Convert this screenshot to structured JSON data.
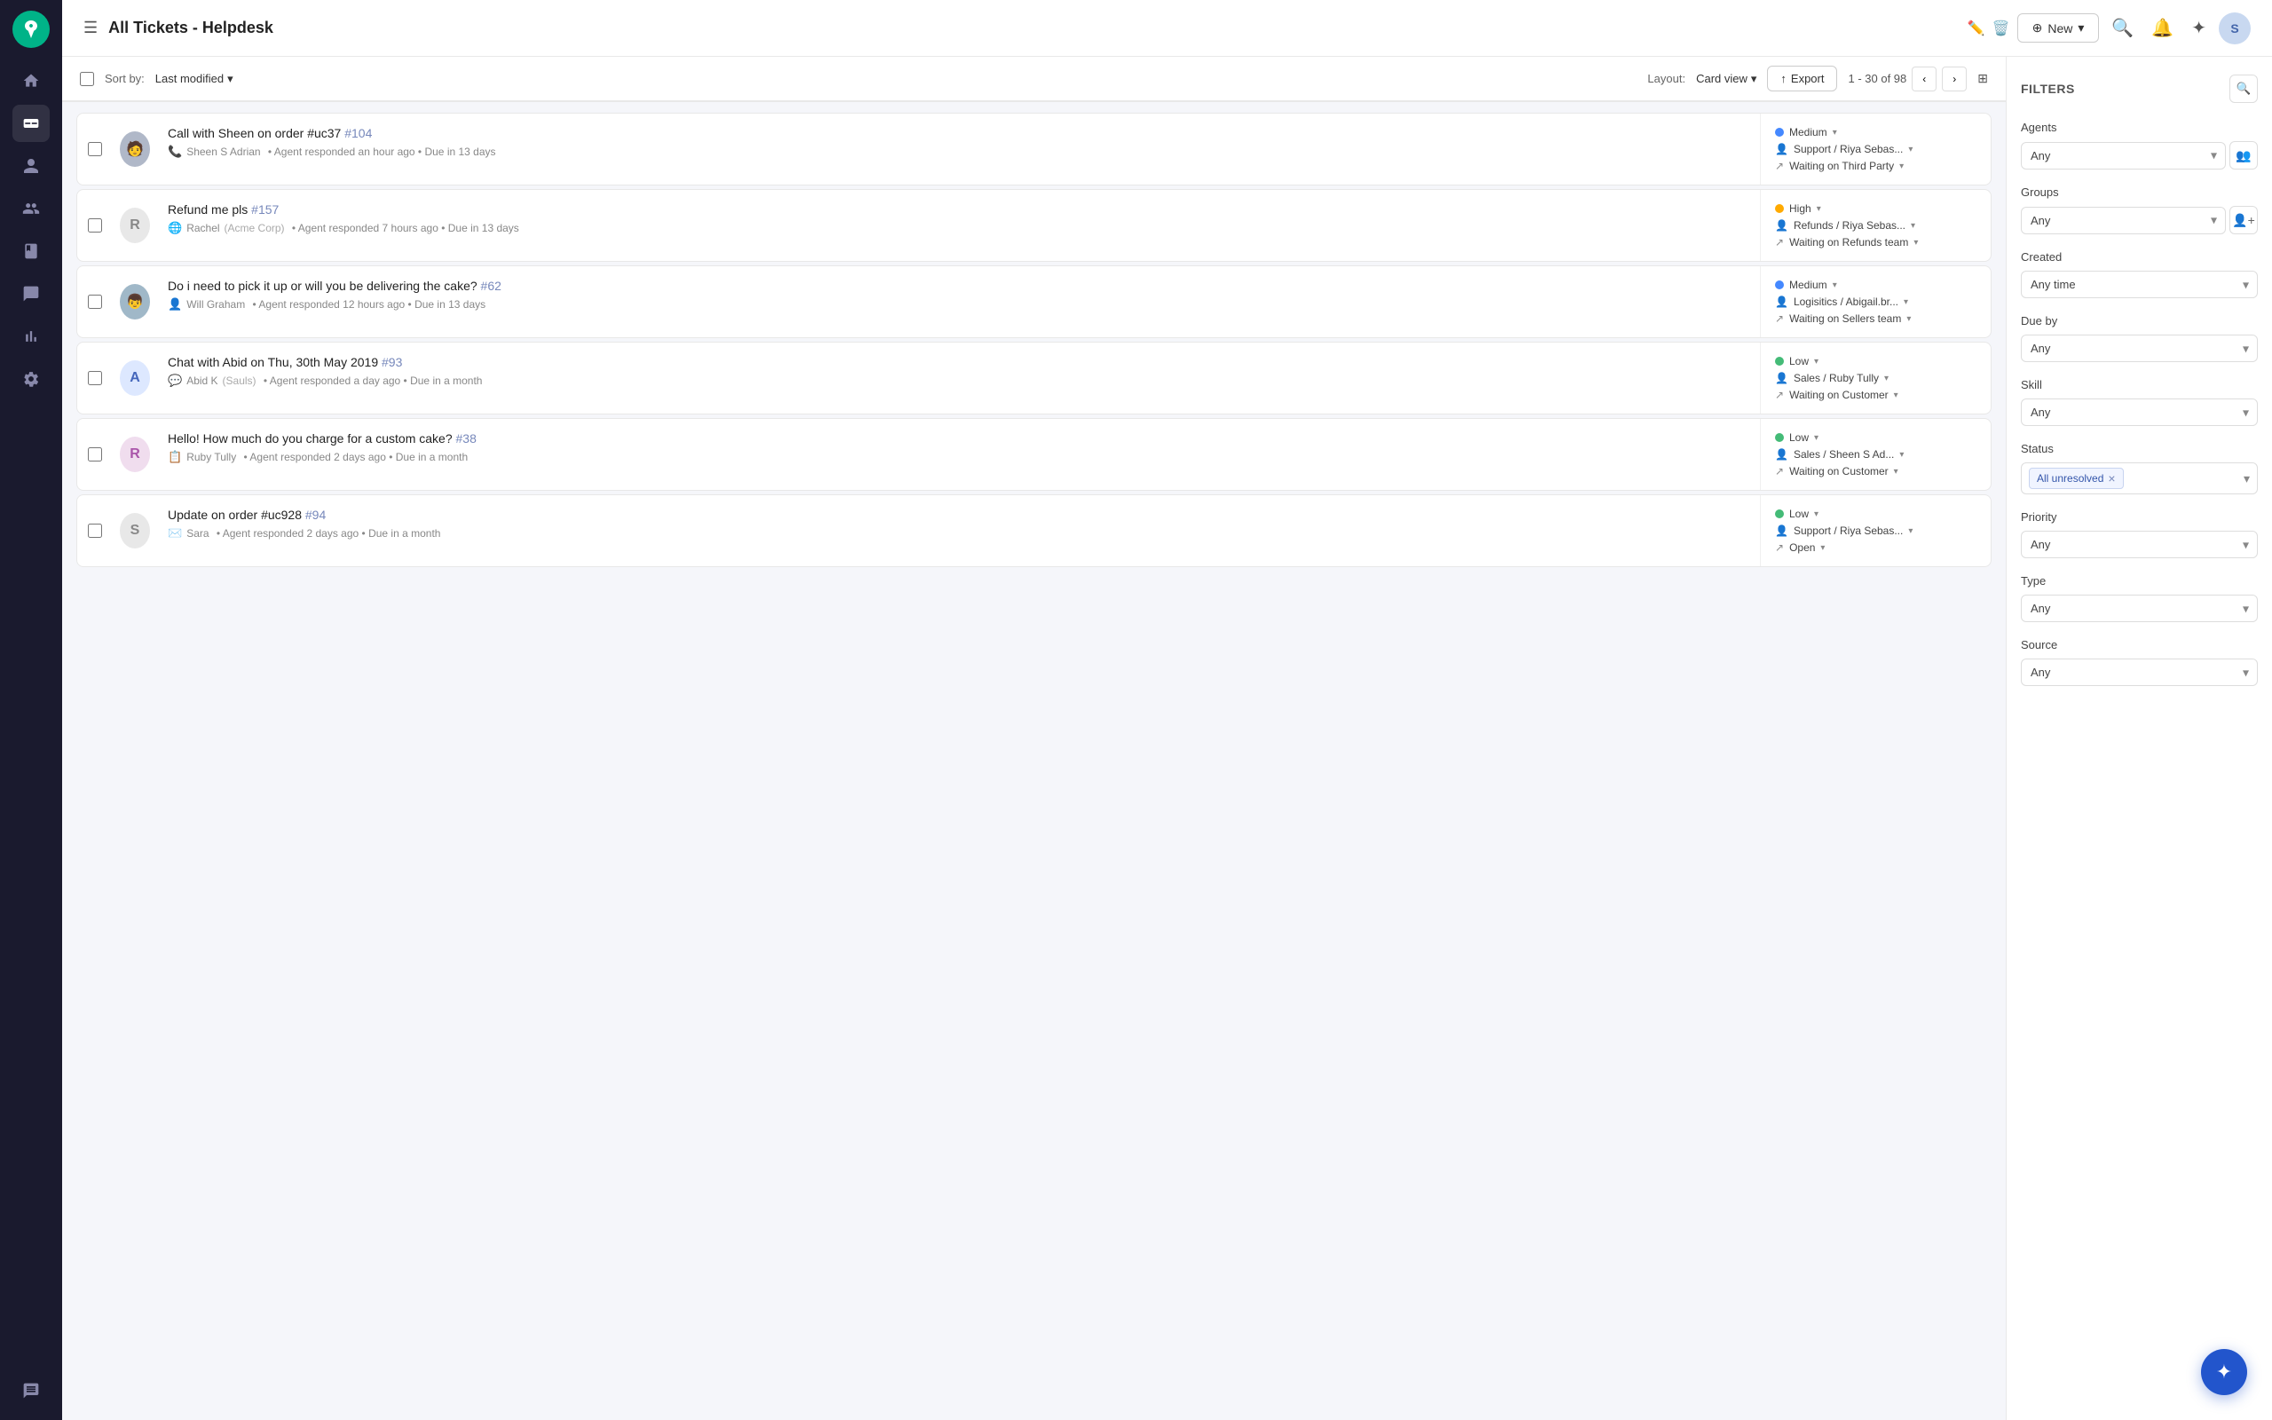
{
  "app": {
    "title": "All Tickets - Helpdesk",
    "new_button": "New",
    "export_button": "Export",
    "pagination": "1 - 30 of 98",
    "sort_label": "Sort by:",
    "sort_value": "Last modified",
    "layout_label": "Layout:",
    "layout_value": "Card view"
  },
  "filters": {
    "title": "FILTERS",
    "agents_label": "Agents",
    "agents_placeholder": "Any",
    "groups_label": "Groups",
    "groups_placeholder": "Any",
    "created_label": "Created",
    "created_value": "Any time",
    "due_by_label": "Due by",
    "due_by_placeholder": "Any",
    "skill_label": "Skill",
    "skill_placeholder": "Any",
    "status_label": "Status",
    "status_value": "All unresolved",
    "priority_label": "Priority",
    "priority_placeholder": "Any",
    "type_label": "Type",
    "type_placeholder": "Any",
    "source_label": "Source"
  },
  "tickets": [
    {
      "id": 1,
      "title": "Call with Sheen on order #uc37",
      "number": "#104",
      "avatar_text": "",
      "avatar_bg": "#c8d0e0",
      "avatar_img": true,
      "contact": "Sheen S Adrian",
      "contact_icon": "📞",
      "meta": "Agent responded an hour ago • Due in 13 days",
      "priority": "Medium",
      "priority_dot": "medium",
      "team": "Support / Riya Sebas...",
      "status": "Waiting on Third Party"
    },
    {
      "id": 2,
      "title": "Refund me pls",
      "number": "#157",
      "avatar_text": "R",
      "avatar_bg": "#e8e8e8",
      "avatar_img": false,
      "contact": "Rachel",
      "contact_org": "(Acme Corp)",
      "contact_icon": "🌐",
      "meta": "Agent responded 7 hours ago • Due in 13 days",
      "priority": "High",
      "priority_dot": "high",
      "team": "Refunds / Riya Sebas...",
      "status": "Waiting on Refunds team"
    },
    {
      "id": 3,
      "title": "Do i need to pick it up or will you be delivering the cake?",
      "number": "#62",
      "avatar_text": "",
      "avatar_bg": "#c8d8e8",
      "avatar_img": true,
      "contact": "Will Graham",
      "contact_icon": "👤",
      "meta": "Agent responded 12 hours ago • Due in 13 days",
      "priority": "Medium",
      "priority_dot": "medium",
      "team": "Logisitics / Abigail.br...",
      "status": "Waiting on Sellers team"
    },
    {
      "id": 4,
      "title": "Chat with Abid on Thu, 30th May 2019",
      "number": "#93",
      "avatar_text": "A",
      "avatar_bg": "#dde8ff",
      "avatar_img": false,
      "contact": "Abid K",
      "contact_org": "(Sauls)",
      "contact_icon": "💬",
      "meta": "Agent responded a day ago • Due in a month",
      "priority": "Low",
      "priority_dot": "low",
      "team": "Sales / Ruby Tully",
      "status": "Waiting on Customer"
    },
    {
      "id": 5,
      "title": "Hello! How much do you charge for a custom cake?",
      "number": "#38",
      "avatar_text": "R",
      "avatar_bg": "#f0ddee",
      "avatar_img": false,
      "contact": "Ruby Tully",
      "contact_icon": "📋",
      "meta": "Agent responded 2 days ago • Due in a month",
      "priority": "Low",
      "priority_dot": "low",
      "team": "Sales / Sheen S Ad...",
      "status": "Waiting on Customer"
    },
    {
      "id": 6,
      "title": "Update on order #uc928",
      "number": "#94",
      "avatar_text": "S",
      "avatar_bg": "#e8e8e8",
      "avatar_img": false,
      "contact": "Sara",
      "contact_icon": "✉️",
      "meta": "Agent responded 2 days ago • Due in a month",
      "priority": "Low",
      "priority_dot": "low",
      "team": "Support / Riya Sebas...",
      "status": "Open"
    }
  ],
  "sidebar": {
    "icons": [
      "home",
      "tickets",
      "contacts",
      "reports",
      "knowledge",
      "conversations",
      "analytics",
      "settings",
      "chat"
    ]
  }
}
